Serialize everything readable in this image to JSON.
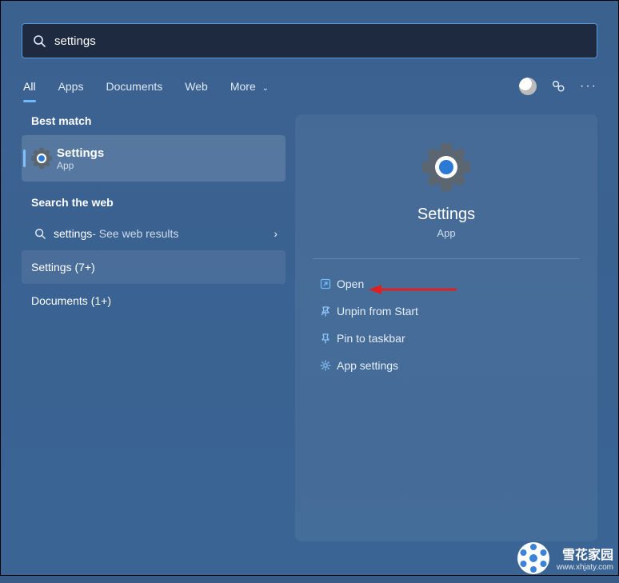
{
  "search": {
    "query": "settings"
  },
  "tabs": {
    "items": [
      "All",
      "Apps",
      "Documents",
      "Web",
      "More"
    ],
    "active_index": 0
  },
  "left": {
    "best_match_header": "Best match",
    "best_match": {
      "title": "Settings",
      "subtitle": "App"
    },
    "web_header": "Search the web",
    "web_item": {
      "query": "settings",
      "suffix": " - See web results"
    },
    "settings_group": "Settings (7+)",
    "documents_group": "Documents (1+)"
  },
  "detail": {
    "title": "Settings",
    "subtitle": "App",
    "actions": {
      "open": "Open",
      "unpin": "Unpin from Start",
      "pin_taskbar": "Pin to taskbar",
      "app_settings": "App settings"
    }
  },
  "watermark": {
    "cn": "雪花家园",
    "en": "www.xhjaty.com"
  },
  "icons": {
    "gear_color_outer": "#5c6670",
    "gear_color_mid": "#ffffff",
    "gear_color_inner": "#2b79d4"
  }
}
